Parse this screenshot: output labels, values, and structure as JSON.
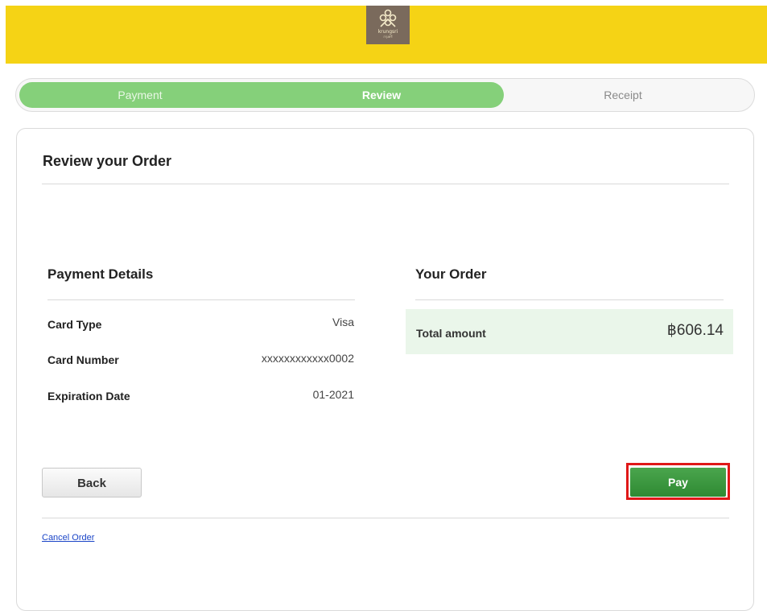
{
  "header": {
    "brand_name": "krungsri",
    "brand_sub": "กรุงศรี",
    "background_color": "#f5d315",
    "logo_icon": "krungsri-logo-icon"
  },
  "steps": {
    "items": [
      {
        "label": "Payment",
        "state": "completed"
      },
      {
        "label": "Review",
        "state": "active"
      },
      {
        "label": "Receipt",
        "state": "pending"
      }
    ],
    "fill_color": "#85d07a"
  },
  "review": {
    "title": "Review your Order"
  },
  "payment_details": {
    "title": "Payment Details",
    "rows": [
      {
        "label": "Card Type",
        "value": "Visa"
      },
      {
        "label": "Card Number",
        "value": "xxxxxxxxxxxx0002"
      },
      {
        "label": "Expiration Date",
        "value": "01-2021"
      }
    ]
  },
  "your_order": {
    "title": "Your Order",
    "total_label": "Total amount",
    "total_value": "฿606.14"
  },
  "actions": {
    "back_label": "Back",
    "pay_label": "Pay",
    "cancel_label": "Cancel Order",
    "pay_color": "#3a9a3e",
    "highlight_color": "#e01818"
  }
}
